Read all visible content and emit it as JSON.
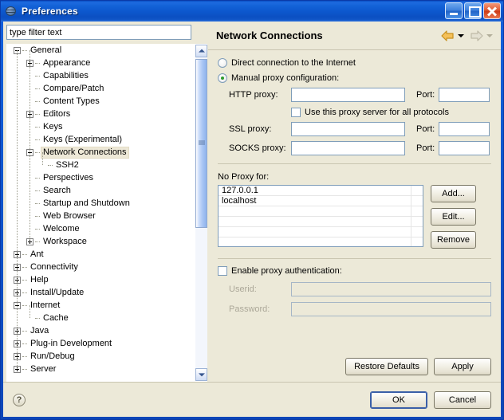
{
  "window": {
    "title": "Preferences",
    "icon": "globe-icon",
    "controls": {
      "minimize": "minimize-button",
      "maximize": "maximize-button",
      "close": "close-button"
    }
  },
  "sidebar": {
    "filter": {
      "value": "type filter text",
      "placeholder": "type filter text"
    },
    "tree": [
      {
        "label": "General",
        "depth": 0,
        "twisty": "minus"
      },
      {
        "label": "Appearance",
        "depth": 1,
        "twisty": "plus"
      },
      {
        "label": "Capabilities",
        "depth": 1,
        "twisty": "none"
      },
      {
        "label": "Compare/Patch",
        "depth": 1,
        "twisty": "none"
      },
      {
        "label": "Content Types",
        "depth": 1,
        "twisty": "none"
      },
      {
        "label": "Editors",
        "depth": 1,
        "twisty": "plus"
      },
      {
        "label": "Keys",
        "depth": 1,
        "twisty": "none"
      },
      {
        "label": "Keys (Experimental)",
        "depth": 1,
        "twisty": "none"
      },
      {
        "label": "Network Connections",
        "depth": 1,
        "twisty": "minus",
        "selected": true
      },
      {
        "label": "SSH2",
        "depth": 2,
        "twisty": "none"
      },
      {
        "label": "Perspectives",
        "depth": 1,
        "twisty": "none"
      },
      {
        "label": "Search",
        "depth": 1,
        "twisty": "none"
      },
      {
        "label": "Startup and Shutdown",
        "depth": 1,
        "twisty": "none"
      },
      {
        "label": "Web Browser",
        "depth": 1,
        "twisty": "none"
      },
      {
        "label": "Welcome",
        "depth": 1,
        "twisty": "none"
      },
      {
        "label": "Workspace",
        "depth": 1,
        "twisty": "plus"
      },
      {
        "label": "Ant",
        "depth": 0,
        "twisty": "plus"
      },
      {
        "label": "Connectivity",
        "depth": 0,
        "twisty": "plus"
      },
      {
        "label": "Help",
        "depth": 0,
        "twisty": "plus"
      },
      {
        "label": "Install/Update",
        "depth": 0,
        "twisty": "plus"
      },
      {
        "label": "Internet",
        "depth": 0,
        "twisty": "minus"
      },
      {
        "label": "Cache",
        "depth": 1,
        "twisty": "none"
      },
      {
        "label": "Java",
        "depth": 0,
        "twisty": "plus"
      },
      {
        "label": "Plug-in Development",
        "depth": 0,
        "twisty": "plus"
      },
      {
        "label": "Run/Debug",
        "depth": 0,
        "twisty": "plus"
      },
      {
        "label": "Server",
        "depth": 0,
        "twisty": "plus"
      }
    ]
  },
  "page": {
    "title": "Network Connections",
    "nav": {
      "back": "back-arrow-icon",
      "forward": "forward-arrow-icon"
    },
    "connection_mode": {
      "direct_label": "Direct connection to the Internet",
      "manual_label": "Manual proxy configuration:",
      "selected": "manual"
    },
    "proxies": [
      {
        "label": "HTTP proxy:",
        "host": "",
        "port_label": "Port:",
        "port": ""
      },
      {
        "label": "SSL proxy:",
        "host": "",
        "port_label": "Port:",
        "port": ""
      },
      {
        "label": "SOCKS proxy:",
        "host": "",
        "port_label": "Port:",
        "port": ""
      }
    ],
    "use_all_protocols": {
      "label": "Use this proxy server for all protocols",
      "checked": false
    },
    "no_proxy": {
      "label": "No Proxy for:",
      "entries": [
        "127.0.0.1",
        "localhost"
      ],
      "empty_rows": 4,
      "buttons": {
        "add": "Add...",
        "edit": "Edit...",
        "remove": "Remove"
      }
    },
    "auth": {
      "enable_label": "Enable proxy authentication:",
      "enabled": false,
      "userid_label": "Userid:",
      "userid": "",
      "password_label": "Password:",
      "password": ""
    },
    "page_buttons": {
      "restore_defaults": "Restore Defaults",
      "apply": "Apply"
    }
  },
  "footer": {
    "help": "?",
    "ok": "OK",
    "cancel": "Cancel"
  },
  "colors": {
    "dialog_bg": "#ECE9D8",
    "title_blue": "#0D58CE",
    "accent_orange": "#E8A33D",
    "radio_green": "#2E9B2E",
    "selection": "#EDE8D7"
  }
}
